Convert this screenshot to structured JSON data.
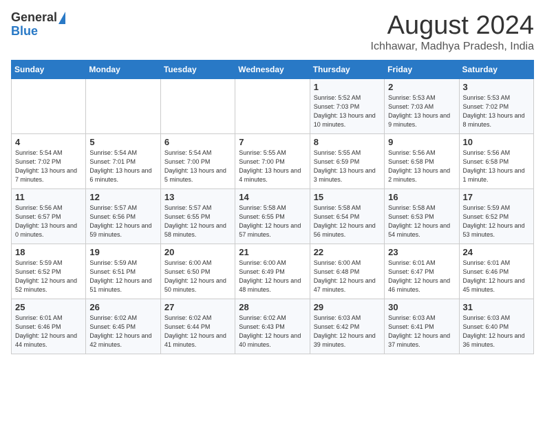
{
  "header": {
    "logo_general": "General",
    "logo_blue": "Blue",
    "title": "August 2024",
    "subtitle": "Ichhawar, Madhya Pradesh, India"
  },
  "weekdays": [
    "Sunday",
    "Monday",
    "Tuesday",
    "Wednesday",
    "Thursday",
    "Friday",
    "Saturday"
  ],
  "weeks": [
    [
      {
        "day": "",
        "sunrise": "",
        "sunset": "",
        "daylight": ""
      },
      {
        "day": "",
        "sunrise": "",
        "sunset": "",
        "daylight": ""
      },
      {
        "day": "",
        "sunrise": "",
        "sunset": "",
        "daylight": ""
      },
      {
        "day": "",
        "sunrise": "",
        "sunset": "",
        "daylight": ""
      },
      {
        "day": "1",
        "sunrise": "Sunrise: 5:52 AM",
        "sunset": "Sunset: 7:03 PM",
        "daylight": "Daylight: 13 hours and 10 minutes."
      },
      {
        "day": "2",
        "sunrise": "Sunrise: 5:53 AM",
        "sunset": "Sunset: 7:03 AM",
        "daylight": "Daylight: 13 hours and 9 minutes."
      },
      {
        "day": "3",
        "sunrise": "Sunrise: 5:53 AM",
        "sunset": "Sunset: 7:02 PM",
        "daylight": "Daylight: 13 hours and 8 minutes."
      }
    ],
    [
      {
        "day": "4",
        "sunrise": "Sunrise: 5:54 AM",
        "sunset": "Sunset: 7:02 PM",
        "daylight": "Daylight: 13 hours and 7 minutes."
      },
      {
        "day": "5",
        "sunrise": "Sunrise: 5:54 AM",
        "sunset": "Sunset: 7:01 PM",
        "daylight": "Daylight: 13 hours and 6 minutes."
      },
      {
        "day": "6",
        "sunrise": "Sunrise: 5:54 AM",
        "sunset": "Sunset: 7:00 PM",
        "daylight": "Daylight: 13 hours and 5 minutes."
      },
      {
        "day": "7",
        "sunrise": "Sunrise: 5:55 AM",
        "sunset": "Sunset: 7:00 PM",
        "daylight": "Daylight: 13 hours and 4 minutes."
      },
      {
        "day": "8",
        "sunrise": "Sunrise: 5:55 AM",
        "sunset": "Sunset: 6:59 PM",
        "daylight": "Daylight: 13 hours and 3 minutes."
      },
      {
        "day": "9",
        "sunrise": "Sunrise: 5:56 AM",
        "sunset": "Sunset: 6:58 PM",
        "daylight": "Daylight: 13 hours and 2 minutes."
      },
      {
        "day": "10",
        "sunrise": "Sunrise: 5:56 AM",
        "sunset": "Sunset: 6:58 PM",
        "daylight": "Daylight: 13 hours and 1 minute."
      }
    ],
    [
      {
        "day": "11",
        "sunrise": "Sunrise: 5:56 AM",
        "sunset": "Sunset: 6:57 PM",
        "daylight": "Daylight: 13 hours and 0 minutes."
      },
      {
        "day": "12",
        "sunrise": "Sunrise: 5:57 AM",
        "sunset": "Sunset: 6:56 PM",
        "daylight": "Daylight: 12 hours and 59 minutes."
      },
      {
        "day": "13",
        "sunrise": "Sunrise: 5:57 AM",
        "sunset": "Sunset: 6:55 PM",
        "daylight": "Daylight: 12 hours and 58 minutes."
      },
      {
        "day": "14",
        "sunrise": "Sunrise: 5:58 AM",
        "sunset": "Sunset: 6:55 PM",
        "daylight": "Daylight: 12 hours and 57 minutes."
      },
      {
        "day": "15",
        "sunrise": "Sunrise: 5:58 AM",
        "sunset": "Sunset: 6:54 PM",
        "daylight": "Daylight: 12 hours and 56 minutes."
      },
      {
        "day": "16",
        "sunrise": "Sunrise: 5:58 AM",
        "sunset": "Sunset: 6:53 PM",
        "daylight": "Daylight: 12 hours and 54 minutes."
      },
      {
        "day": "17",
        "sunrise": "Sunrise: 5:59 AM",
        "sunset": "Sunset: 6:52 PM",
        "daylight": "Daylight: 12 hours and 53 minutes."
      }
    ],
    [
      {
        "day": "18",
        "sunrise": "Sunrise: 5:59 AM",
        "sunset": "Sunset: 6:52 PM",
        "daylight": "Daylight: 12 hours and 52 minutes."
      },
      {
        "day": "19",
        "sunrise": "Sunrise: 5:59 AM",
        "sunset": "Sunset: 6:51 PM",
        "daylight": "Daylight: 12 hours and 51 minutes."
      },
      {
        "day": "20",
        "sunrise": "Sunrise: 6:00 AM",
        "sunset": "Sunset: 6:50 PM",
        "daylight": "Daylight: 12 hours and 50 minutes."
      },
      {
        "day": "21",
        "sunrise": "Sunrise: 6:00 AM",
        "sunset": "Sunset: 6:49 PM",
        "daylight": "Daylight: 12 hours and 48 minutes."
      },
      {
        "day": "22",
        "sunrise": "Sunrise: 6:00 AM",
        "sunset": "Sunset: 6:48 PM",
        "daylight": "Daylight: 12 hours and 47 minutes."
      },
      {
        "day": "23",
        "sunrise": "Sunrise: 6:01 AM",
        "sunset": "Sunset: 6:47 PM",
        "daylight": "Daylight: 12 hours and 46 minutes."
      },
      {
        "day": "24",
        "sunrise": "Sunrise: 6:01 AM",
        "sunset": "Sunset: 6:46 PM",
        "daylight": "Daylight: 12 hours and 45 minutes."
      }
    ],
    [
      {
        "day": "25",
        "sunrise": "Sunrise: 6:01 AM",
        "sunset": "Sunset: 6:46 PM",
        "daylight": "Daylight: 12 hours and 44 minutes."
      },
      {
        "day": "26",
        "sunrise": "Sunrise: 6:02 AM",
        "sunset": "Sunset: 6:45 PM",
        "daylight": "Daylight: 12 hours and 42 minutes."
      },
      {
        "day": "27",
        "sunrise": "Sunrise: 6:02 AM",
        "sunset": "Sunset: 6:44 PM",
        "daylight": "Daylight: 12 hours and 41 minutes."
      },
      {
        "day": "28",
        "sunrise": "Sunrise: 6:02 AM",
        "sunset": "Sunset: 6:43 PM",
        "daylight": "Daylight: 12 hours and 40 minutes."
      },
      {
        "day": "29",
        "sunrise": "Sunrise: 6:03 AM",
        "sunset": "Sunset: 6:42 PM",
        "daylight": "Daylight: 12 hours and 39 minutes."
      },
      {
        "day": "30",
        "sunrise": "Sunrise: 6:03 AM",
        "sunset": "Sunset: 6:41 PM",
        "daylight": "Daylight: 12 hours and 37 minutes."
      },
      {
        "day": "31",
        "sunrise": "Sunrise: 6:03 AM",
        "sunset": "Sunset: 6:40 PM",
        "daylight": "Daylight: 12 hours and 36 minutes."
      }
    ]
  ]
}
